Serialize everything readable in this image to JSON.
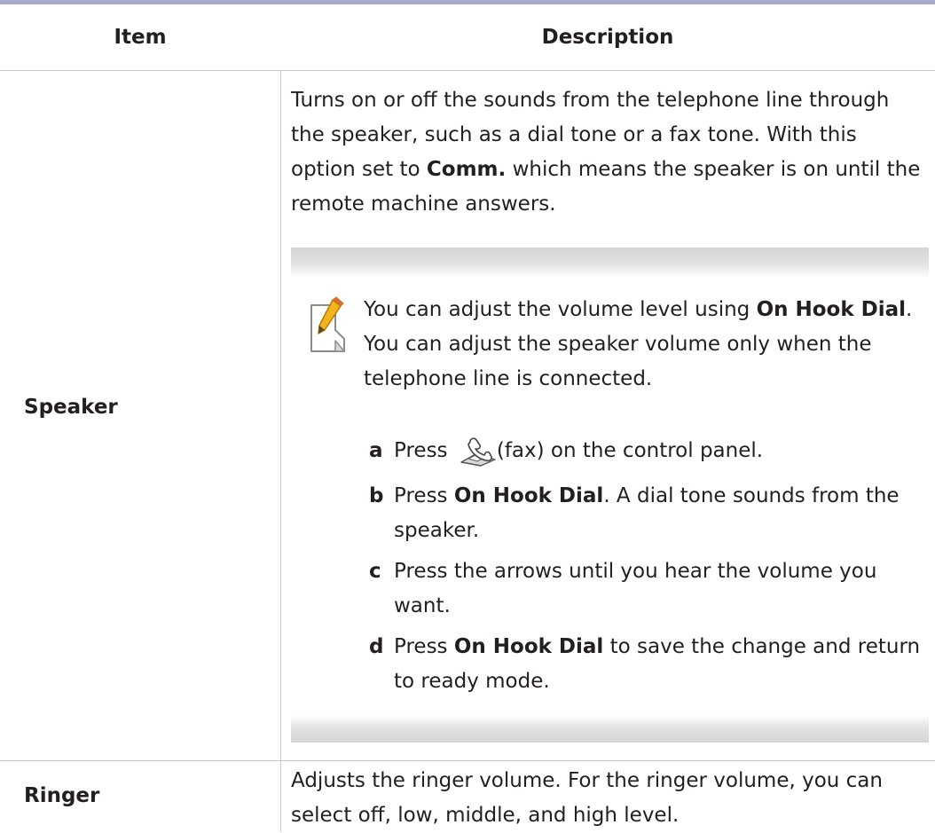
{
  "table": {
    "headers": {
      "item": "Item",
      "description": "Description"
    },
    "rows": [
      {
        "item": "Speaker",
        "description": {
          "part1": "Turns on or off the sounds from the telephone line through the speaker, such as a dial tone or a fax tone. With this option set to ",
          "bold1": "Comm.",
          "part2": " which means the speaker is on until the remote machine answers."
        },
        "note": {
          "icon": "note-pencil-icon",
          "pre": "You can adjust the volume level using ",
          "bold": "On Hook Dial",
          "post": ". You can adjust the speaker volume only when the telephone line is connected.",
          "steps": [
            {
              "letter": "a",
              "pre": "Press ",
              "icon": "fax-icon",
              "post": "(fax) on the control panel."
            },
            {
              "letter": "b",
              "pre": "Press ",
              "bold": "On Hook Dial",
              "post": ". A dial tone sounds from the speaker."
            },
            {
              "letter": "c",
              "text": "Press the arrows until you hear the volume you want."
            },
            {
              "letter": "d",
              "pre": "Press ",
              "bold": "On Hook Dial",
              "post": " to save the change and return to ready mode."
            }
          ]
        }
      },
      {
        "item": "Ringer",
        "description": "Adjusts the ringer volume. For the ringer volume, you can select off, low, middle, and high level."
      }
    ]
  },
  "colors": {
    "header_rule": "#a9a9cf",
    "grid": "#c9c9c9",
    "text": "#231f20",
    "pencil": "#f2b31b"
  }
}
